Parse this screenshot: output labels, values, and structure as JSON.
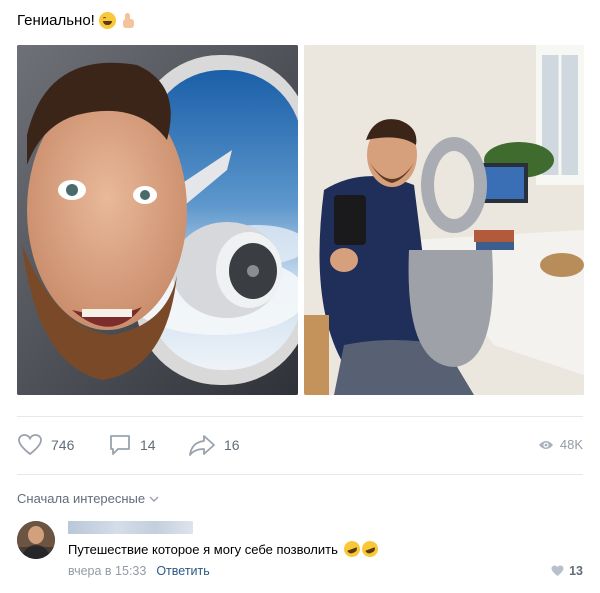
{
  "post": {
    "text": "Гениально!",
    "emojis": [
      "laughing-face",
      "thumbs-up"
    ]
  },
  "actions": {
    "likes": "746",
    "comments": "14",
    "shares": "16",
    "views": "48K"
  },
  "comments_section": {
    "sort_label": "Сначала интересные",
    "comment": {
      "text": "Путешествие которое я могу себе позволить",
      "emojis": [
        "rolling-on-floor-laughing",
        "rolling-on-floor-laughing"
      ],
      "time": "вчера в 15:33",
      "reply_label": "Ответить",
      "likes": "13"
    }
  },
  "colors": {
    "link": "#2a5885",
    "secondary_text": "#626d7a",
    "muted_text": "#939ba5",
    "divider": "#e7e8ec"
  }
}
